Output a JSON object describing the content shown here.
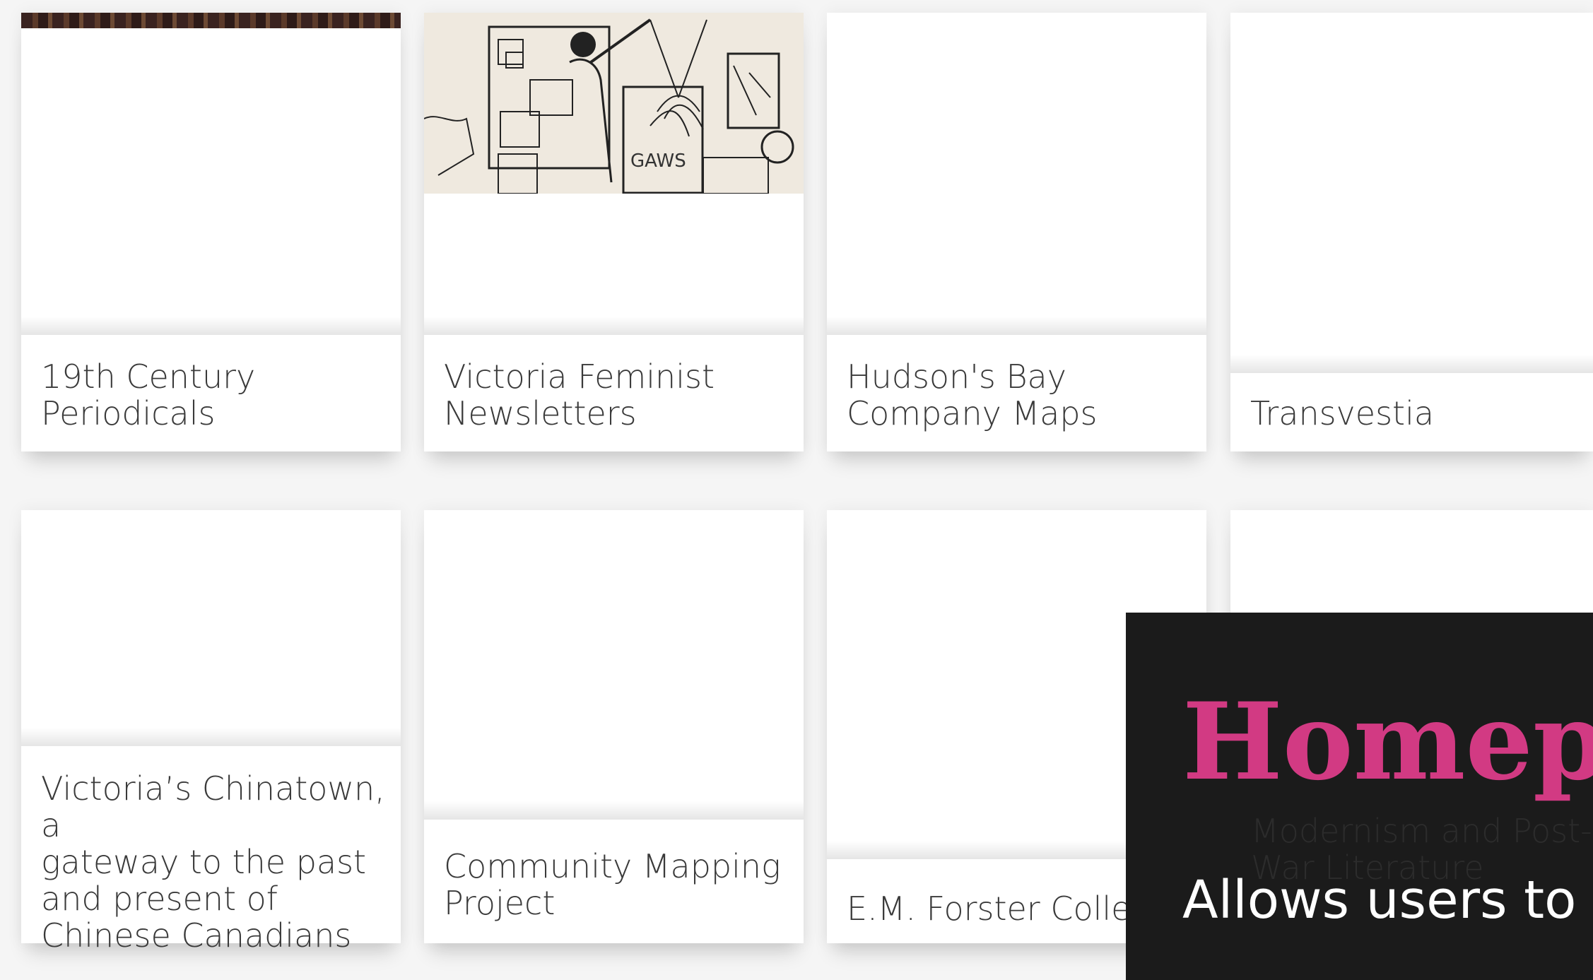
{
  "cards": [
    {
      "title_lines": [
        "19th Century",
        "Periodicals"
      ]
    },
    {
      "title_lines": [
        "Victoria Feminist",
        "Newsletters"
      ],
      "image_alt": "sketch-drawing"
    },
    {
      "title_lines": [
        "Hudson's Bay",
        "Company Maps"
      ]
    },
    {
      "title_lines": [
        "Transvestia"
      ]
    },
    {
      "title_lines": [
        "Victoria’s Chinatown, a",
        "gateway to the past",
        "and present of",
        "Chinese Canadians"
      ]
    },
    {
      "title_lines": [
        "Community Mapping",
        "Project"
      ]
    },
    {
      "title_lines": [
        "E.M. Forster Collection"
      ]
    },
    {
      "title_lines": [
        "Modernism and Post-",
        "War Literature"
      ]
    }
  ],
  "tooltip": {
    "title": "Homepa",
    "description": "Allows users to fi"
  },
  "colors": {
    "page_bg": "#f5f5f5",
    "card_bg": "#ffffff",
    "tooltip_bg": "#1b1b1b",
    "tooltip_accent": "#d23a83"
  }
}
